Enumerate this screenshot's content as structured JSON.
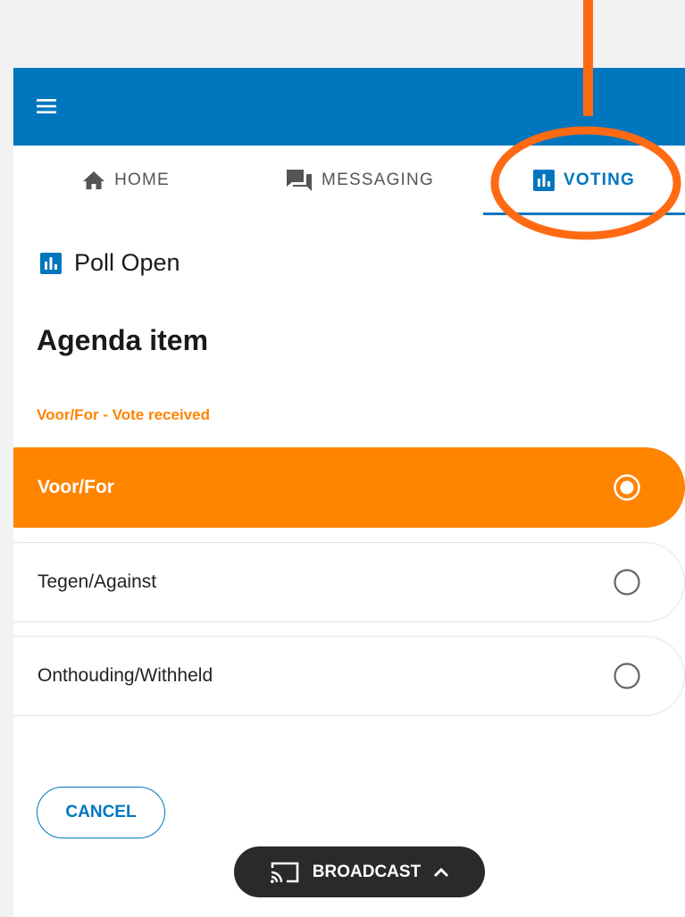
{
  "tabs": {
    "home": "HOME",
    "messaging": "MESSAGING",
    "voting": "VOTING"
  },
  "poll": {
    "status": "Poll Open",
    "agenda_title": "Agenda item",
    "vote_status": "Voor/For - Vote received"
  },
  "options": [
    {
      "label": "Voor/For",
      "selected": true
    },
    {
      "label": "Tegen/Against",
      "selected": false
    },
    {
      "label": "Onthouding/Withheld",
      "selected": false
    }
  ],
  "actions": {
    "cancel": "CANCEL",
    "broadcast": "BROADCAST"
  },
  "colors": {
    "brand_blue": "#0076bf",
    "selected_orange": "#ff8400",
    "annotation_orange": "#ff6a13",
    "broadcast_bg": "#2a2a2a"
  },
  "icons": {
    "menu": "hamburger-menu-icon",
    "home": "home-icon",
    "messaging": "chat-bubbles-icon",
    "voting": "bar-chart-icon",
    "poll": "bar-chart-icon",
    "radio_checked": "radio-checked-icon",
    "radio_unchecked": "radio-unchecked-icon",
    "broadcast": "cast-icon",
    "expand": "chevron-up-icon"
  }
}
